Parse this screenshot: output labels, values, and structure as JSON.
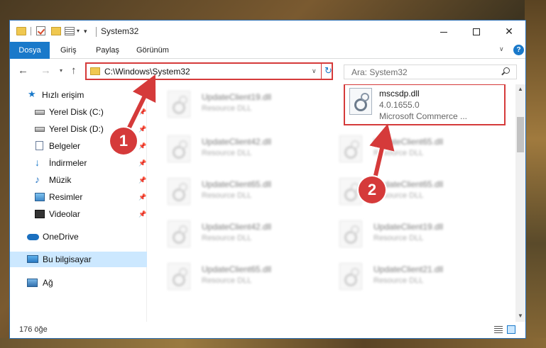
{
  "window": {
    "title": "System32"
  },
  "ribbon": {
    "tabs": [
      "Dosya",
      "Giriş",
      "Paylaş",
      "Görünüm"
    ]
  },
  "address": {
    "path": "C:\\Windows\\System32"
  },
  "search": {
    "placeholder": "Ara: System32"
  },
  "sidebar": {
    "items": [
      {
        "label": "Hızlı erişim",
        "icon": "star-icon"
      },
      {
        "label": "Yerel Disk (C:)",
        "icon": "drive-icon",
        "pinned": true
      },
      {
        "label": "Yerel Disk (D:)",
        "icon": "drive-icon",
        "pinned": true
      },
      {
        "label": "Belgeler",
        "icon": "documents-icon",
        "pinned": true
      },
      {
        "label": "İndirmeler",
        "icon": "download-icon",
        "pinned": true
      },
      {
        "label": "Müzik",
        "icon": "music-icon",
        "pinned": true
      },
      {
        "label": "Resimler",
        "icon": "pictures-icon",
        "pinned": true
      },
      {
        "label": "Videolar",
        "icon": "videos-icon",
        "pinned": true
      },
      {
        "label": "OneDrive",
        "icon": "cloud-icon"
      },
      {
        "label": "Bu bilgisayar",
        "icon": "computer-icon",
        "selected": true
      },
      {
        "label": "Ağ",
        "icon": "network-icon"
      }
    ]
  },
  "files": {
    "left": [
      {
        "name": "UpdateClient19.dll",
        "desc": "Resource DLL"
      },
      {
        "name": "UpdateClient42.dll",
        "desc": "Resource DLL"
      },
      {
        "name": "UpdateClient65.dll",
        "desc": "Resource DLL"
      },
      {
        "name": "UpdateClient42.dll",
        "desc": "Resource DLL"
      },
      {
        "name": "UpdateClient65.dll",
        "desc": "Resource DLL"
      }
    ],
    "right": [
      {
        "name": "UpdateClient65.dll",
        "desc": "Resource DLL"
      },
      {
        "name": "UpdateClient65.dll",
        "desc": "Resource DLL"
      },
      {
        "name": "UpdateClient19.dll",
        "desc": "Resource DLL"
      },
      {
        "name": "UpdateClient21.dll",
        "desc": "Resource DLL"
      }
    ],
    "highlighted": {
      "name": "mscsdp.dll",
      "version": "4.0.1655.0",
      "desc": "Microsoft Commerce ..."
    }
  },
  "status": {
    "count": "176 öğe"
  },
  "annotations": {
    "callout_1": "1",
    "callout_2": "2",
    "accent_color": "#d53a3a"
  }
}
